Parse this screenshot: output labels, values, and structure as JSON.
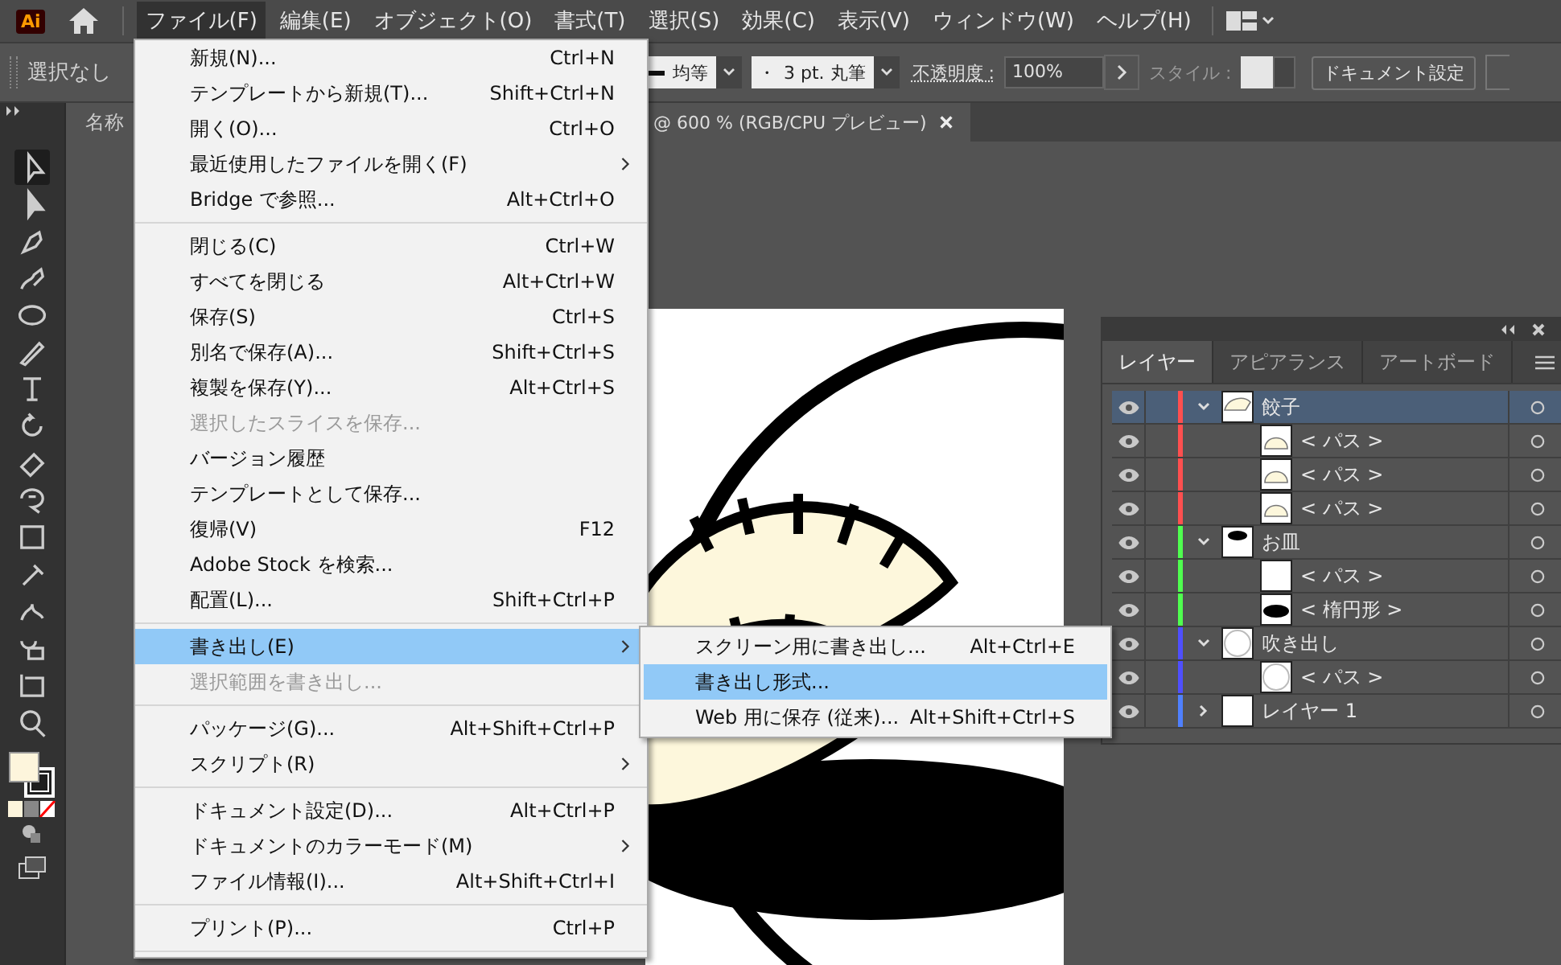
{
  "app_logo": "Ai",
  "menubar": [
    {
      "label": "ファイル(F)",
      "selected": true
    },
    {
      "label": "編集(E)",
      "selected": false
    },
    {
      "label": "オブジェクト(O)",
      "selected": false
    },
    {
      "label": "書式(T)",
      "selected": false
    },
    {
      "label": "選択(S)",
      "selected": false
    },
    {
      "label": "効果(C)",
      "selected": false
    },
    {
      "label": "表示(V)",
      "selected": false
    },
    {
      "label": "ウィンドウ(W)",
      "selected": false
    },
    {
      "label": "ヘルプ(H)",
      "selected": false
    }
  ],
  "control_bar": {
    "selection": "選択なし",
    "stroke_profile": "均等",
    "brush_dot": "・",
    "brush": "3 pt. 丸筆",
    "opacity_label": "不透明度 :",
    "opacity": "100%",
    "style_label": "スタイル :",
    "document_button": "ドキュメント設定"
  },
  "document_tab": {
    "title_start": "名称",
    "title_end": "@ 600 % (RGB/CPU プレビュー)"
  },
  "file_menu": [
    [
      {
        "label": "新規(N)...",
        "shortcut": "Ctrl+N",
        "submenu": false,
        "disabled": false,
        "selected": false
      },
      {
        "label": "テンプレートから新規(T)...",
        "shortcut": "Shift+Ctrl+N",
        "submenu": false,
        "disabled": false,
        "selected": false
      },
      {
        "label": "開く(O)...",
        "shortcut": "Ctrl+O",
        "submenu": false,
        "disabled": false,
        "selected": false
      },
      {
        "label": "最近使用したファイルを開く(F)",
        "submenu": true,
        "disabled": false,
        "selected": false
      },
      {
        "label": "Bridge で参照...",
        "shortcut": "Alt+Ctrl+O",
        "submenu": false,
        "disabled": false,
        "selected": false
      }
    ],
    [
      {
        "label": "閉じる(C)",
        "shortcut": "Ctrl+W",
        "submenu": false,
        "disabled": false,
        "selected": false
      },
      {
        "label": "すべてを閉じる",
        "shortcut": "Alt+Ctrl+W",
        "submenu": false,
        "disabled": false,
        "selected": false
      },
      {
        "label": "保存(S)",
        "shortcut": "Ctrl+S",
        "submenu": false,
        "disabled": false,
        "selected": false
      },
      {
        "label": "別名で保存(A)...",
        "shortcut": "Shift+Ctrl+S",
        "submenu": false,
        "disabled": false,
        "selected": false
      },
      {
        "label": "複製を保存(Y)...",
        "shortcut": "Alt+Ctrl+S",
        "submenu": false,
        "disabled": false,
        "selected": false
      },
      {
        "label": "選択したスライスを保存...",
        "submenu": false,
        "disabled": true,
        "selected": false
      },
      {
        "label": "バージョン履歴",
        "submenu": false,
        "disabled": false,
        "selected": false
      },
      {
        "label": "テンプレートとして保存...",
        "submenu": false,
        "disabled": false,
        "selected": false
      },
      {
        "label": "復帰(V)",
        "shortcut": "F12",
        "submenu": false,
        "disabled": false,
        "selected": false
      },
      {
        "label": "Adobe Stock を検索...",
        "submenu": false,
        "disabled": false,
        "selected": false
      },
      {
        "label": "配置(L)...",
        "shortcut": "Shift+Ctrl+P",
        "submenu": false,
        "disabled": false,
        "selected": false
      }
    ],
    [
      {
        "label": "書き出し(E)",
        "submenu": true,
        "disabled": false,
        "selected": true
      },
      {
        "label": "選択範囲を書き出し...",
        "submenu": false,
        "disabled": true,
        "selected": false
      }
    ],
    [
      {
        "label": "パッケージ(G)...",
        "shortcut": "Alt+Shift+Ctrl+P",
        "submenu": false,
        "disabled": false,
        "selected": false
      },
      {
        "label": "スクリプト(R)",
        "submenu": true,
        "disabled": false,
        "selected": false
      }
    ],
    [
      {
        "label": "ドキュメント設定(D)...",
        "shortcut": "Alt+Ctrl+P",
        "submenu": false,
        "disabled": false,
        "selected": false
      },
      {
        "label": "ドキュメントのカラーモード(M)",
        "submenu": true,
        "disabled": false,
        "selected": false
      },
      {
        "label": "ファイル情報(I)...",
        "shortcut": "Alt+Shift+Ctrl+I",
        "submenu": false,
        "disabled": false,
        "selected": false
      }
    ],
    [
      {
        "label": "プリント(P)...",
        "shortcut": "Ctrl+P",
        "submenu": false,
        "disabled": false,
        "selected": false
      }
    ]
  ],
  "export_submenu": [
    {
      "label": "スクリーン用に書き出し...",
      "shortcut": "Alt+Ctrl+E",
      "selected": false
    },
    {
      "label": "書き出し形式...",
      "selected": true
    },
    {
      "label": "Web 用に保存 (従来)...",
      "shortcut": "Alt+Shift+Ctrl+S",
      "selected": false
    }
  ],
  "layers_panel": {
    "tabs": [
      {
        "label": "レイヤー",
        "selected": true
      },
      {
        "label": "アピアランス",
        "selected": false
      },
      {
        "label": "アートボード",
        "selected": false
      }
    ],
    "layers": [
      {
        "name": "餃子",
        "color": "#ff4f4f",
        "expanded": true,
        "selected": true,
        "kind": "dumplings",
        "children": [
          {
            "name": "< パス >",
            "kind": "dumpling"
          },
          {
            "name": "< パス >",
            "kind": "dumpling"
          },
          {
            "name": "< パス >",
            "kind": "dumpling"
          }
        ]
      },
      {
        "name": "お皿",
        "color": "#4fff4f",
        "expanded": true,
        "selected": false,
        "kind": "plate",
        "children": [
          {
            "name": "< パス >",
            "kind": "blank"
          },
          {
            "name": "< 楕円形 >",
            "kind": "ellipse"
          }
        ]
      },
      {
        "name": "吹き出し",
        "color": "#4f4fff",
        "expanded": true,
        "selected": false,
        "kind": "circle",
        "children": [
          {
            "name": "< パス >",
            "kind": "circle"
          }
        ]
      },
      {
        "name": "レイヤー 1",
        "color": "#4f80ff",
        "expanded": false,
        "selected": false,
        "kind": "blank"
      }
    ]
  }
}
